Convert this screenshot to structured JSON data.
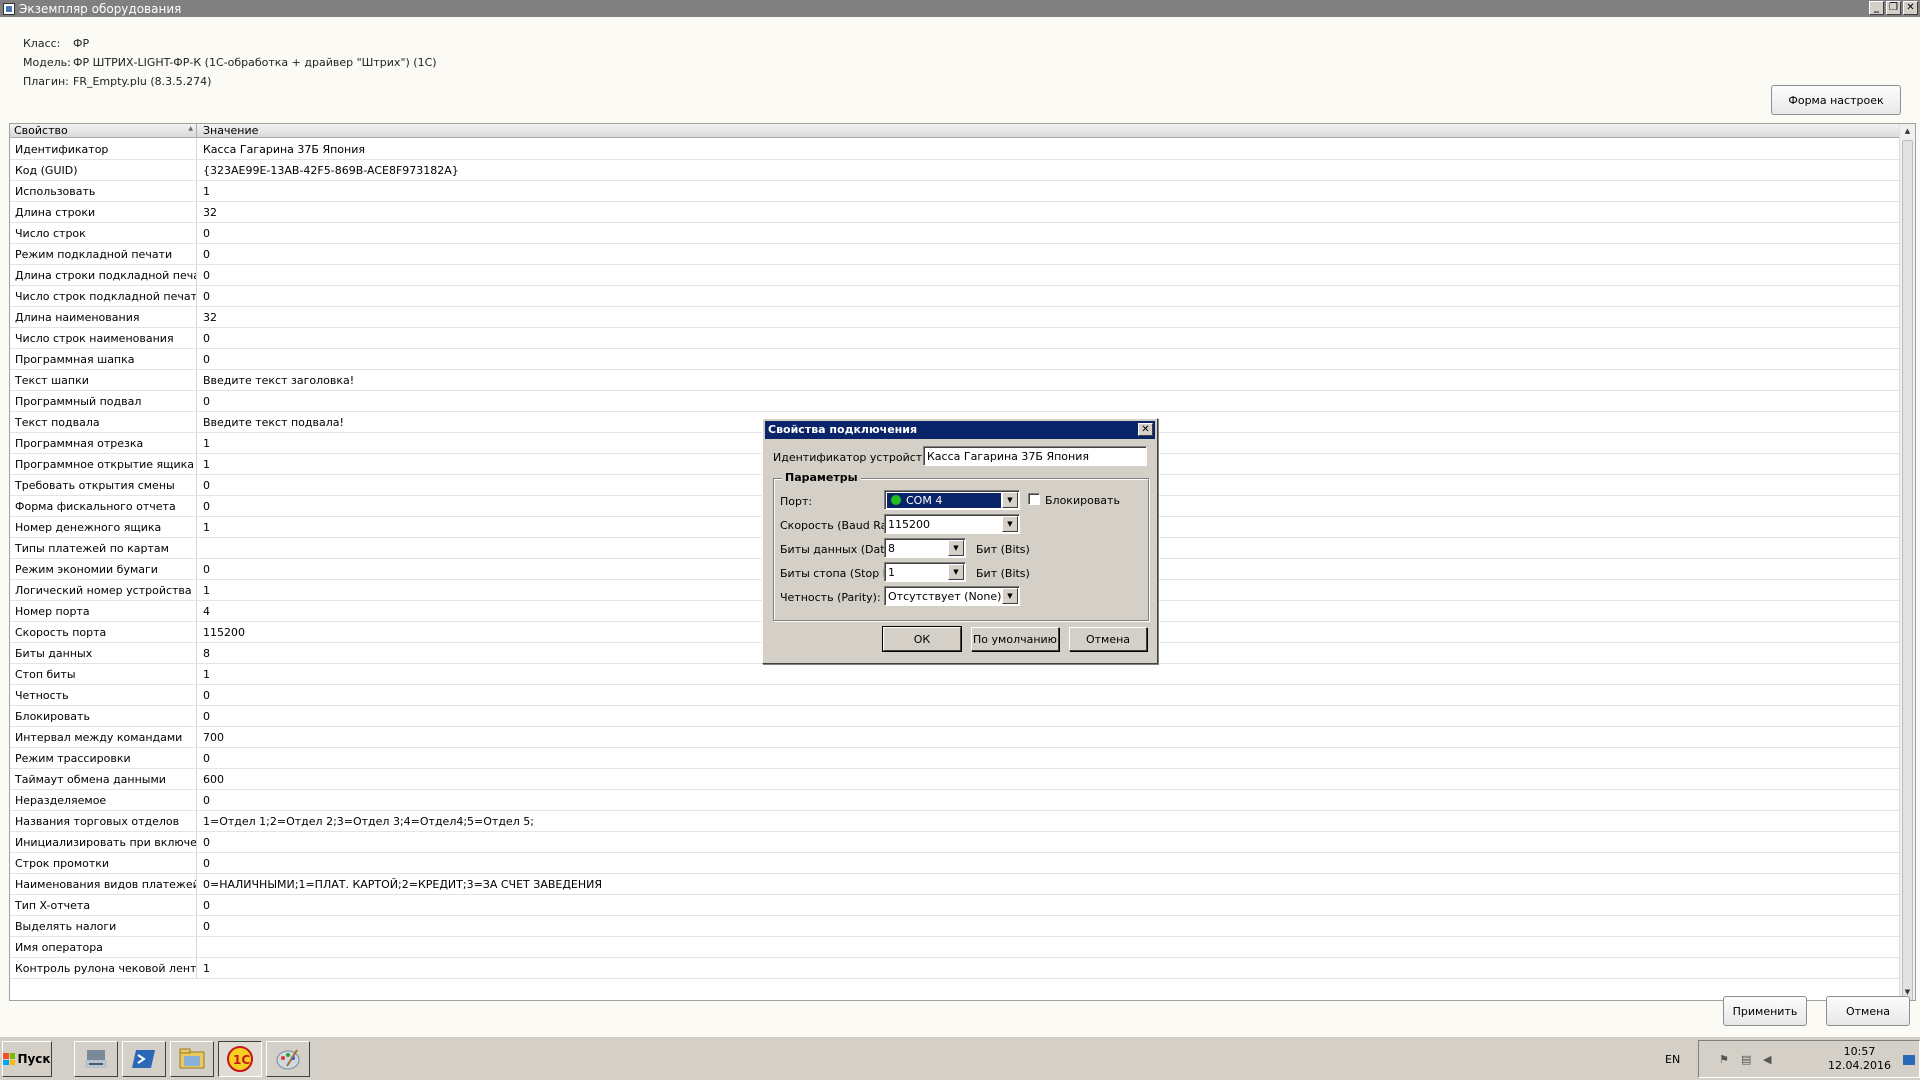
{
  "window": {
    "title": "Экземпляр оборудования"
  },
  "info": {
    "class_label": "Класс:",
    "class_value": "ФР",
    "model_label": "Модель:",
    "model_value": "ФР ШТРИХ-LIGHT-ФР-К (1С-обработка + драйвер \"Штрих\") (1С)",
    "plugin_label": "Плагин:",
    "plugin_value": "FR_Empty.plu (8.3.5.274)"
  },
  "settings_button": "Форма настроек",
  "grid": {
    "col_property": "Свойство",
    "col_value": "Значение",
    "rows": [
      {
        "p": "Идентификатор",
        "v": "Касса Гагарина 37Б Япония"
      },
      {
        "p": "Код (GUID)",
        "v": "{323AE99E-13AB-42F5-869B-ACE8F973182A}"
      },
      {
        "p": "Использовать",
        "v": "1"
      },
      {
        "p": "Длина строки",
        "v": "32"
      },
      {
        "p": "Число строк",
        "v": "0"
      },
      {
        "p": "Режим подкладной печати",
        "v": "0"
      },
      {
        "p": "Длина строки подкладной печати",
        "v": "0"
      },
      {
        "p": "Число строк подкладной печати",
        "v": "0"
      },
      {
        "p": "Длина наименования",
        "v": "32"
      },
      {
        "p": "Число строк наименования",
        "v": "0"
      },
      {
        "p": "Программная шапка",
        "v": "0"
      },
      {
        "p": "Текст шапки",
        "v": "Введите текст заголовка!"
      },
      {
        "p": "Программный подвал",
        "v": "0"
      },
      {
        "p": "Текст подвала",
        "v": "Введите текст подвала!"
      },
      {
        "p": "Программная отрезка",
        "v": "1"
      },
      {
        "p": "Программное открытие ящика",
        "v": "1"
      },
      {
        "p": "Требовать открытия смены",
        "v": "0"
      },
      {
        "p": "Форма фискального отчета",
        "v": "0"
      },
      {
        "p": "Номер денежного ящика",
        "v": "1"
      },
      {
        "p": "Типы платежей по картам",
        "v": ""
      },
      {
        "p": "Режим экономии бумаги",
        "v": "0"
      },
      {
        "p": "Логический номер устройства",
        "v": "1"
      },
      {
        "p": "Номер порта",
        "v": "4"
      },
      {
        "p": "Скорость порта",
        "v": "115200"
      },
      {
        "p": "Биты данных",
        "v": "8"
      },
      {
        "p": "Стоп биты",
        "v": "1"
      },
      {
        "p": "Четность",
        "v": "0"
      },
      {
        "p": "Блокировать",
        "v": "0"
      },
      {
        "p": "Интервал между командами",
        "v": "700"
      },
      {
        "p": "Режим трассировки",
        "v": "0"
      },
      {
        "p": "Таймаут обмена данными",
        "v": "600"
      },
      {
        "p": "Неразделяемое",
        "v": "0"
      },
      {
        "p": "Названия торговых отделов",
        "v": "1=Отдел 1;2=Отдел 2;3=Отдел 3;4=Отдел4;5=Отдел 5;"
      },
      {
        "p": "Инициализировать при включении",
        "v": "0"
      },
      {
        "p": "Строк промотки",
        "v": "0"
      },
      {
        "p": "Наименования видов платежей",
        "v": "0=НАЛИЧНЫМИ;1=ПЛАТ. КАРТОЙ;2=КРЕДИТ;3=ЗА СЧЕТ ЗАВЕДЕНИЯ"
      },
      {
        "p": "Тип X-отчета",
        "v": "0"
      },
      {
        "p": "Выделять налоги",
        "v": "0"
      },
      {
        "p": "Имя оператора",
        "v": ""
      },
      {
        "p": "Контроль рулона чековой ленты",
        "v": "1"
      }
    ]
  },
  "footer": {
    "apply": "Применить",
    "cancel": "Отмена"
  },
  "dialog": {
    "title": "Свойства подключения",
    "device_id_label": "Идентификатор устройства:",
    "device_id_value": "Касса Гагарина 37Б Япония",
    "group_title": "Параметры",
    "port_label": "Порт:",
    "port_value": "COM 4",
    "block_label": "Блокировать",
    "baud_label": "Скорость (Baud Rate):",
    "baud_value": "115200",
    "databits_label": "Биты данных (Data bits):",
    "databits_value": "8",
    "databits_unit": "Бит (Bits)",
    "stopbits_label": "Биты стопа (Stop bits):",
    "stopbits_value": "1",
    "stopbits_unit": "Бит (Bits)",
    "parity_label": "Четность (Parity):",
    "parity_value": "Отсутствует (None)",
    "ok": "ОК",
    "default": "По умолчанию",
    "cancel": "Отмена"
  },
  "taskbar": {
    "start": "Пуск",
    "lang": "EN",
    "time": "10:57",
    "date": "12.04.2016",
    "apps": [
      "server-manager-icon",
      "powershell-icon",
      "explorer-icon",
      "1c-icon",
      "paint-icon"
    ]
  },
  "colors": {
    "dialog_title": "#0a246a",
    "status_green": "#22c01f",
    "titlebar": "#808080"
  }
}
